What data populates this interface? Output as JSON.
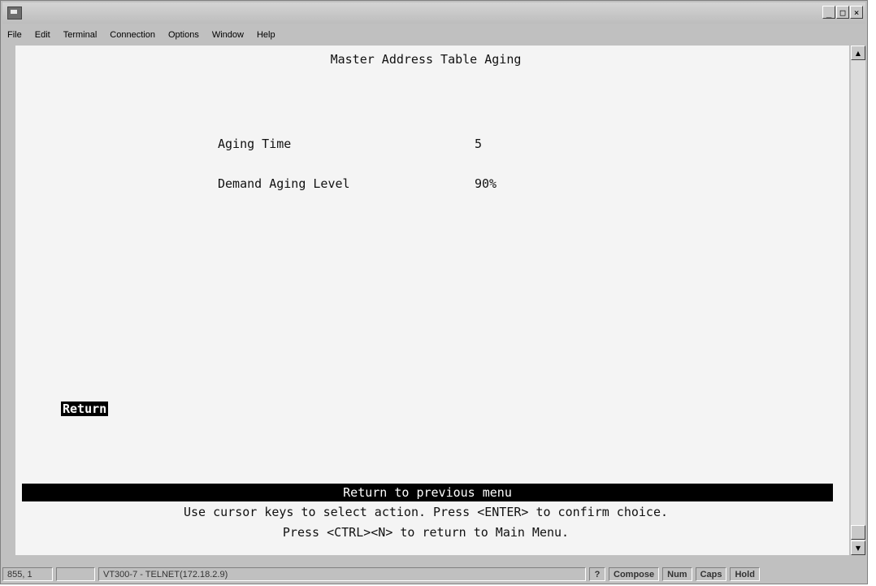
{
  "window": {
    "menus": [
      "File",
      "Edit",
      "Terminal",
      "Connection",
      "Options",
      "Window",
      "Help"
    ]
  },
  "screen": {
    "title": "Master Address Table Aging",
    "fields": [
      {
        "label": "Aging Time",
        "value": "5"
      },
      {
        "label": "Demand Aging Level",
        "value": "90%"
      }
    ],
    "return_label": "Return",
    "help_text": "Return to previous menu",
    "instruction_1": "Use cursor keys to select action. Press <ENTER> to confirm choice.",
    "instruction_2": "Press <CTRL><N> to return to Main Menu."
  },
  "status": {
    "position": "855, 1",
    "session": "VT300-7 - TELNET(172.18.2.9)",
    "help": "?",
    "compose": "Compose",
    "num": "Num",
    "caps": "Caps",
    "hold": "Hold"
  }
}
